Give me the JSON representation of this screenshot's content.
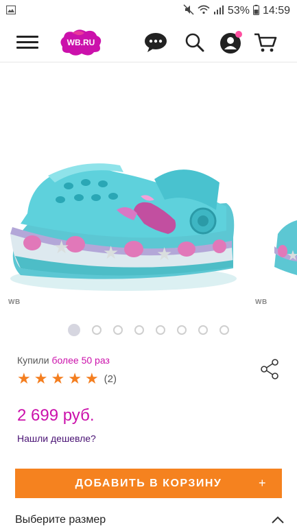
{
  "status_bar": {
    "battery": "53%",
    "time": "14:59"
  },
  "header": {
    "logo_text": "WB.RU",
    "cart_badge_color": "#ff4fa0"
  },
  "gallery": {
    "watermark_left": "WB",
    "watermark_right": "WB",
    "dot_count": 8,
    "active_index": 0
  },
  "product": {
    "bought_prefix": "Купили",
    "bought_value": "более 50 раз",
    "rating": 5,
    "reviews_count": "(2)",
    "price": "2 699 руб.",
    "cheaper_link": "Нашли дешевле?",
    "add_to_cart": "ДОБАВИТЬ В КОРЗИНУ",
    "add_plus": "+",
    "size_label": "Выберите размер"
  },
  "colors": {
    "accent": "#cb11ab",
    "button": "#f5821f",
    "star": "#f47e1f",
    "link": "#481173"
  }
}
